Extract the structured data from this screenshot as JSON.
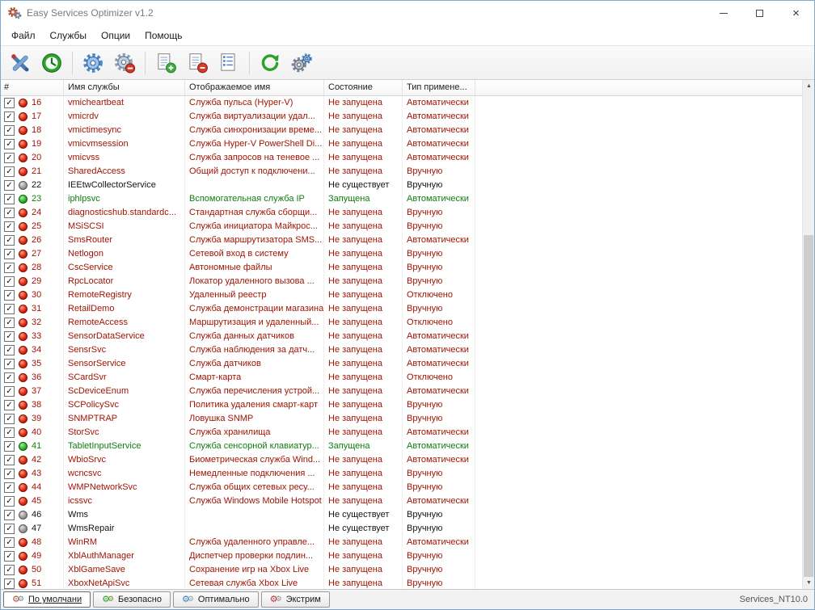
{
  "window": {
    "title": "Easy Services Optimizer v1.2"
  },
  "menu": {
    "items": [
      "Файл",
      "Службы",
      "Опции",
      "Помощь"
    ]
  },
  "toolbar": {
    "icons": [
      "optimize-tools-icon",
      "timer-clock-icon",
      "start-services-gear-icon",
      "stop-services-gear-icon",
      "add-service-doc-icon",
      "remove-service-doc-icon",
      "services-list-doc-icon",
      "refresh-icon",
      "settings-gears-icon"
    ]
  },
  "table": {
    "columns": [
      "#",
      "Имя службы",
      "Отображаемое имя",
      "Состояние",
      "Тип примене..."
    ],
    "rows": [
      {
        "n": 16,
        "checked": true,
        "status": "stopped",
        "name": "vmicheartbeat",
        "display": "Служба пульса (Hyper-V)",
        "state": "Не запущена",
        "type": "Автоматически"
      },
      {
        "n": 17,
        "checked": true,
        "status": "stopped",
        "name": "vmicrdv",
        "display": "Служба виртуализации удал...",
        "state": "Не запущена",
        "type": "Автоматически"
      },
      {
        "n": 18,
        "checked": true,
        "status": "stopped",
        "name": "vmictimesync",
        "display": "Служба синхронизации време...",
        "state": "Не запущена",
        "type": "Автоматически"
      },
      {
        "n": 19,
        "checked": true,
        "status": "stopped",
        "name": "vmicvmsession",
        "display": "Служба Hyper-V PowerShell Di...",
        "state": "Не запущена",
        "type": "Автоматически"
      },
      {
        "n": 20,
        "checked": true,
        "status": "stopped",
        "name": "vmicvss",
        "display": "Служба запросов на теневое ...",
        "state": "Не запущена",
        "type": "Автоматически"
      },
      {
        "n": 21,
        "checked": true,
        "status": "stopped",
        "name": "SharedAccess",
        "display": "Общий доступ к подключени...",
        "state": "Не запущена",
        "type": "Вручную"
      },
      {
        "n": 22,
        "checked": true,
        "status": "missing",
        "name": "IEEtwCollectorService",
        "display": "",
        "state": "Не существует",
        "type": "Вручную"
      },
      {
        "n": 23,
        "checked": true,
        "status": "running",
        "name": "iphlpsvc",
        "display": "Вспомогательная служба IP",
        "state": "Запущена",
        "type": "Автоматически"
      },
      {
        "n": 24,
        "checked": true,
        "status": "stopped",
        "name": "diagnosticshub.standardc...",
        "display": "Стандартная служба сборщи...",
        "state": "Не запущена",
        "type": "Вручную"
      },
      {
        "n": 25,
        "checked": true,
        "status": "stopped",
        "name": "MSiSCSI",
        "display": "Служба инициатора Майкрос...",
        "state": "Не запущена",
        "type": "Вручную"
      },
      {
        "n": 26,
        "checked": true,
        "status": "stopped",
        "name": "SmsRouter",
        "display": "Служба маршрутизатора SMS...",
        "state": "Не запущена",
        "type": "Автоматически"
      },
      {
        "n": 27,
        "checked": true,
        "status": "stopped",
        "name": "Netlogon",
        "display": "Сетевой вход в систему",
        "state": "Не запущена",
        "type": "Вручную"
      },
      {
        "n": 28,
        "checked": true,
        "status": "stopped",
        "name": "CscService",
        "display": "Автономные файлы",
        "state": "Не запущена",
        "type": "Вручную"
      },
      {
        "n": 29,
        "checked": true,
        "status": "stopped",
        "name": "RpcLocator",
        "display": "Локатор удаленного вызова ...",
        "state": "Не запущена",
        "type": "Вручную"
      },
      {
        "n": 30,
        "checked": true,
        "status": "stopped",
        "name": "RemoteRegistry",
        "display": "Удаленный реестр",
        "state": "Не запущена",
        "type": "Отключено"
      },
      {
        "n": 31,
        "checked": true,
        "status": "stopped",
        "name": "RetailDemo",
        "display": "Служба демонстрации магазина",
        "state": "Не запущена",
        "type": "Вручную"
      },
      {
        "n": 32,
        "checked": true,
        "status": "stopped",
        "name": "RemoteAccess",
        "display": "Маршрутизация и удаленный...",
        "state": "Не запущена",
        "type": "Отключено"
      },
      {
        "n": 33,
        "checked": true,
        "status": "stopped",
        "name": "SensorDataService",
        "display": "Служба данных датчиков",
        "state": "Не запущена",
        "type": "Автоматически"
      },
      {
        "n": 34,
        "checked": true,
        "status": "stopped",
        "name": "SensrSvc",
        "display": "Служба наблюдения за датч...",
        "state": "Не запущена",
        "type": "Автоматически"
      },
      {
        "n": 35,
        "checked": true,
        "status": "stopped",
        "name": "SensorService",
        "display": "Служба датчиков",
        "state": "Не запущена",
        "type": "Автоматически"
      },
      {
        "n": 36,
        "checked": true,
        "status": "stopped",
        "name": "SCardSvr",
        "display": "Смарт-карта",
        "state": "Не запущена",
        "type": "Отключено"
      },
      {
        "n": 37,
        "checked": true,
        "status": "stopped",
        "name": "ScDeviceEnum",
        "display": "Служба перечисления устрой...",
        "state": "Не запущена",
        "type": "Автоматически"
      },
      {
        "n": 38,
        "checked": true,
        "status": "stopped",
        "name": "SCPolicySvc",
        "display": "Политика удаления смарт-карт",
        "state": "Не запущена",
        "type": "Вручную"
      },
      {
        "n": 39,
        "checked": true,
        "status": "stopped",
        "name": "SNMPTRAP",
        "display": "Ловушка SNMP",
        "state": "Не запущена",
        "type": "Вручную"
      },
      {
        "n": 40,
        "checked": true,
        "status": "stopped",
        "name": "StorSvc",
        "display": "Служба хранилища",
        "state": "Не запущена",
        "type": "Автоматически"
      },
      {
        "n": 41,
        "checked": true,
        "status": "running",
        "name": "TabletInputService",
        "display": "Служба сенсорной клавиатур...",
        "state": "Запущена",
        "type": "Автоматически"
      },
      {
        "n": 42,
        "checked": true,
        "status": "stopped",
        "name": "WbioSrvc",
        "display": "Биометрическая служба Wind...",
        "state": "Не запущена",
        "type": "Автоматически"
      },
      {
        "n": 43,
        "checked": true,
        "status": "stopped",
        "name": "wcncsvc",
        "display": "Немедленные подключения ...",
        "state": "Не запущена",
        "type": "Вручную"
      },
      {
        "n": 44,
        "checked": true,
        "status": "stopped",
        "name": "WMPNetworkSvc",
        "display": "Служба общих сетевых ресу...",
        "state": "Не запущена",
        "type": "Вручную"
      },
      {
        "n": 45,
        "checked": true,
        "status": "stopped",
        "name": "icssvc",
        "display": "Служба Windows Mobile Hotspot",
        "state": "Не запущена",
        "type": "Автоматически"
      },
      {
        "n": 46,
        "checked": true,
        "status": "missing",
        "name": "Wms",
        "display": "",
        "state": "Не существует",
        "type": "Вручную"
      },
      {
        "n": 47,
        "checked": true,
        "status": "missing",
        "name": "WmsRepair",
        "display": "",
        "state": "Не существует",
        "type": "Вручную"
      },
      {
        "n": 48,
        "checked": true,
        "status": "stopped",
        "name": "WinRM",
        "display": "Служба удаленного управле...",
        "state": "Не запущена",
        "type": "Автоматически"
      },
      {
        "n": 49,
        "checked": true,
        "status": "stopped",
        "name": "XblAuthManager",
        "display": "Диспетчер проверки подлин...",
        "state": "Не запущена",
        "type": "Вручную"
      },
      {
        "n": 50,
        "checked": true,
        "status": "stopped",
        "name": "XblGameSave",
        "display": "Сохранение игр на Xbox Live",
        "state": "Не запущена",
        "type": "Вручную"
      },
      {
        "n": 51,
        "checked": true,
        "status": "stopped",
        "name": "XboxNetApiSvc",
        "display": "Сетевая служба Xbox Live",
        "state": "Не запущена",
        "type": "Вручную"
      }
    ]
  },
  "tabs": {
    "items": [
      {
        "label": "По умолчани",
        "icon": "gears-default-icon",
        "active": true
      },
      {
        "label": "Безопасно",
        "icon": "gears-safe-icon",
        "active": false
      },
      {
        "label": "Оптимально",
        "icon": "gears-optimal-icon",
        "active": false
      },
      {
        "label": "Экстрим",
        "icon": "gears-extreme-icon",
        "active": false
      }
    ]
  },
  "statusbar": {
    "right": "Services_NT10.0"
  }
}
